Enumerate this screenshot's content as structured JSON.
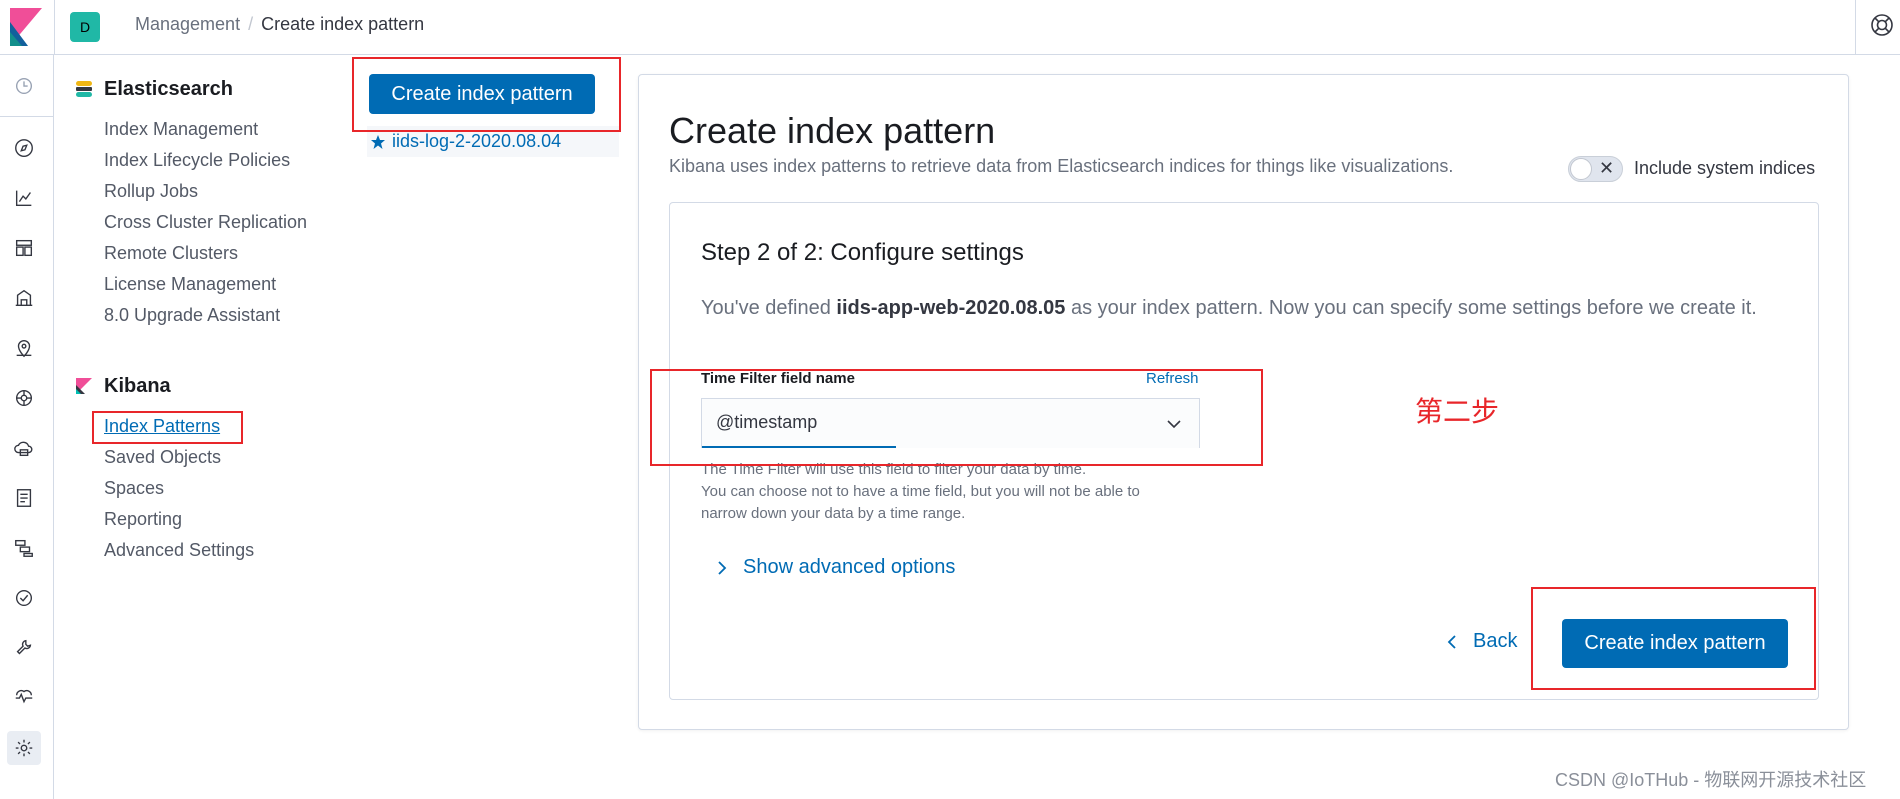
{
  "header": {
    "space_initial": "D",
    "breadcrumbs": [
      "Management",
      "Create index pattern"
    ],
    "separator": "/"
  },
  "sidebar": {
    "elasticsearch": {
      "title": "Elasticsearch",
      "items": [
        "Index Management",
        "Index Lifecycle Policies",
        "Rollup Jobs",
        "Cross Cluster Replication",
        "Remote Clusters",
        "License Management",
        "8.0 Upgrade Assistant"
      ]
    },
    "kibana": {
      "title": "Kibana",
      "items": [
        "Index Patterns",
        "Saved Objects",
        "Spaces",
        "Reporting",
        "Advanced Settings"
      ],
      "selected": "Index Patterns"
    }
  },
  "patterns_list": {
    "create_button": "Create index pattern",
    "items": [
      "iids-log-2-2020.08.04"
    ]
  },
  "main": {
    "title": "Create index pattern",
    "description": "Kibana uses index patterns to retrieve data from Elasticsearch indices for things like visualizations.",
    "include_system_label": "Include system indices",
    "step": {
      "title": "Step 2 of 2: Configure settings",
      "desc_prefix": "You've defined ",
      "desc_pattern": "iids-app-web-2020.08.05",
      "desc_suffix": " as your index pattern. Now you can specify some settings before we create it.",
      "field_label": "Time Filter field name",
      "refresh": "Refresh",
      "selected_field": "@timestamp",
      "help_line1": "The Time Filter will use this field to filter your data by time.",
      "help_line2": "You can choose not to have a time field, but you will not be able to",
      "help_line3": "narrow down your data by a time range.",
      "advanced": "Show advanced options",
      "back": "Back",
      "create": "Create index pattern"
    }
  },
  "annotation": "第二步",
  "watermark": "CSDN @IoTHub - 物联网开源技术社区",
  "colors": {
    "primary": "#006bb4",
    "annotation_red": "#e8262a"
  }
}
